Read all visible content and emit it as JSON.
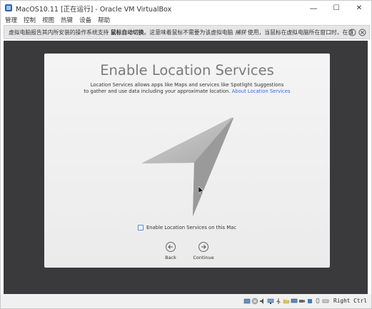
{
  "window": {
    "title": "MacOS10.11 [正在运行] - Oracle VM VirtualBox",
    "minimize": "—",
    "maximize": "☐",
    "close": "✕"
  },
  "menu": {
    "items": [
      {
        "label": "管理"
      },
      {
        "label": "控制"
      },
      {
        "label": "视图"
      },
      {
        "label": "热键"
      },
      {
        "label": "设备"
      },
      {
        "label": "帮助"
      }
    ]
  },
  "notice": {
    "text_before": "虚拟电脑报告其内所安装的操作系统支持",
    "text_bold": "鼠标自动切换",
    "text_after": "。这意味着鼠标不需要为该虚拟电脑",
    "text_italic": "捕获",
    "text_end": "使用，当鼠标在虚拟电脑所在窗口时，在该"
  },
  "dialog": {
    "title": "Enable Location Services",
    "desc_line1": "Location Services allows apps like Maps and services like Spotlight Suggestions",
    "desc_line2": "to gather and use data including your approximate location.",
    "link": "About Location Services",
    "checkbox_label": "Enable Location Services on this Mac",
    "back_label": "Back",
    "continue_label": "Continue"
  },
  "status": {
    "hostkey": "Right Ctrl"
  },
  "colors": {
    "vm_bg": "#3a3a3c",
    "dialog_bg": "#f0f0f0",
    "link": "#2a6fd6",
    "checkbox_border": "#4a8ae0"
  }
}
